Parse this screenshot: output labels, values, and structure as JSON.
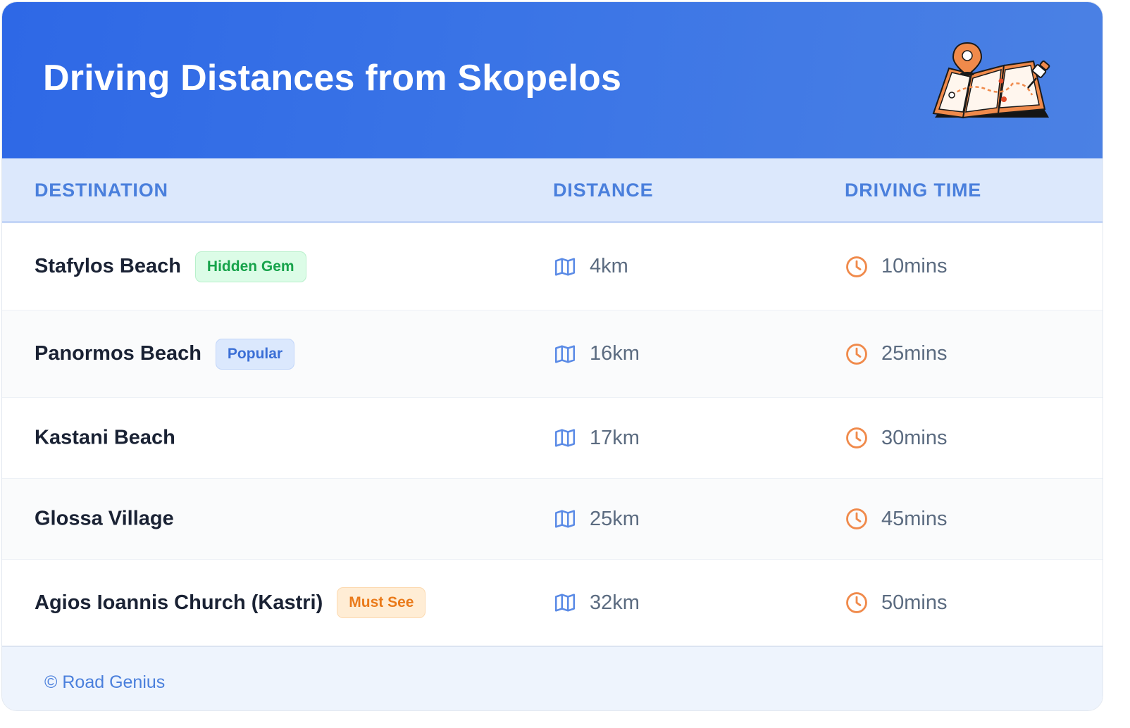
{
  "header": {
    "title": "Driving Distances from Skopelos",
    "illustration_icon": "map-with-pins-icon"
  },
  "table": {
    "columns": [
      "DESTINATION",
      "DISTANCE",
      "DRIVING TIME"
    ],
    "rows": [
      {
        "destination": "Stafylos Beach",
        "badge": "Hidden Gem",
        "badge_color": "#16a34a",
        "distance": "4km",
        "time": "10mins"
      },
      {
        "destination": "Panormos Beach",
        "badge": "Popular",
        "badge_color": "#3b6fd6",
        "distance": "16km",
        "time": "25mins"
      },
      {
        "destination": "Kastani Beach",
        "distance": "17km",
        "time": "30mins"
      },
      {
        "destination": "Glossa Village",
        "distance": "25km",
        "time": "45mins"
      },
      {
        "destination": "Agios Ioannis Church (Kastri)",
        "badge": "Must See",
        "badge_color": "#ea7a1a",
        "distance": "32km",
        "time": "50mins"
      }
    ],
    "distance_icon": "map-icon",
    "time_icon": "clock-icon"
  },
  "footer": {
    "text": "© Road Genius"
  },
  "colors": {
    "header_bg": "#3a74e6",
    "accent": "#4a7fdc",
    "clock": "#f08a4b"
  }
}
